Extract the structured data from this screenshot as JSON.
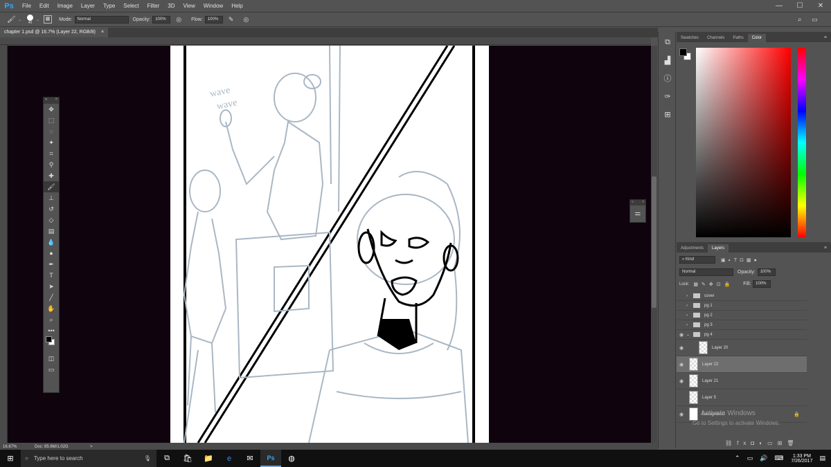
{
  "app": {
    "logo": "Ps"
  },
  "menu": [
    "File",
    "Edit",
    "Image",
    "Layer",
    "Type",
    "Select",
    "Filter",
    "3D",
    "View",
    "Window",
    "Help"
  ],
  "window_controls": {
    "minimize": "—",
    "maximize": "☐",
    "close": "✕"
  },
  "options": {
    "brush_size": "40",
    "mode_label": "Mode:",
    "mode_value": "Normal",
    "opacity_label": "Opacity:",
    "opacity_value": "100%",
    "flow_label": "Flow:",
    "flow_value": "100%"
  },
  "document": {
    "tab_title": "chapter 1.psd @ 16.7% (Layer 22, RGB/8)",
    "tab_close": "×",
    "sketch_text_1": "wave",
    "sketch_text_2": "wave"
  },
  "status": {
    "zoom": "16.67%",
    "doc_info": "Doc: 85.6M/1.02G",
    "arrow": ">"
  },
  "color_panel": {
    "tabs": [
      "Swatches",
      "Channels",
      "Paths",
      "Color"
    ],
    "active_tab": "Color",
    "foreground": "#000000",
    "background": "#ffffff"
  },
  "layers_panel": {
    "tabs": [
      "Adjustments",
      "Layers"
    ],
    "active_tab": "Layers",
    "filter_label": "Kind",
    "blend_mode": "Normal",
    "opacity_label": "Opacity:",
    "opacity_value": "100%",
    "lock_label": "Lock:",
    "fill_label": "Fill:",
    "fill_value": "100%",
    "layers": [
      {
        "name": "cover",
        "type": "group",
        "visible": false
      },
      {
        "name": "pg 1",
        "type": "group",
        "visible": false
      },
      {
        "name": "pg 2",
        "type": "group",
        "visible": false
      },
      {
        "name": "pg 3",
        "type": "group",
        "visible": false
      },
      {
        "name": "pg 4",
        "type": "group",
        "visible": true,
        "expanded": true
      },
      {
        "name": "Layer 20",
        "type": "layer",
        "visible": true
      },
      {
        "name": "Layer 22",
        "type": "layer",
        "visible": true,
        "selected": true
      },
      {
        "name": "Layer 21",
        "type": "layer",
        "visible": true
      },
      {
        "name": "Layer 5",
        "type": "layer",
        "visible": false
      },
      {
        "name": "Background",
        "type": "layer",
        "visible": true,
        "locked": true
      }
    ]
  },
  "watermark": {
    "line1": "Activate Windows",
    "line2": "Go to Settings to activate Windows."
  },
  "taskbar": {
    "search_placeholder": "Type here to search",
    "time": "1:33 PM",
    "date": "7/26/2017"
  },
  "colors": {
    "canvas_bg": "#0f040e",
    "sketch": "#a9b7c4",
    "panel": "#535353",
    "accent_ps": "#31a8ff"
  }
}
